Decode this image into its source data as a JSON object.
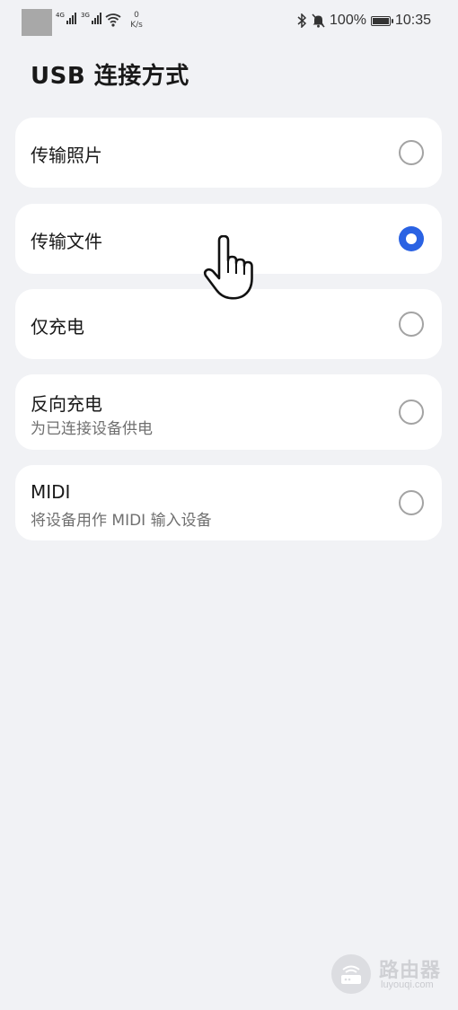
{
  "status_bar": {
    "net1": "4G",
    "net2": "3G",
    "speed_value": "0",
    "speed_unit": "K/s",
    "battery": "100%",
    "time": "10:35",
    "battery_level": 1.0,
    "icons": [
      "bluetooth-icon",
      "mute-icon",
      "wifi-icon",
      "signal-icon",
      "battery-icon"
    ]
  },
  "page": {
    "title": "USB 连接方式"
  },
  "options": [
    {
      "label": "传输照片",
      "selected": false
    },
    {
      "label": "传输文件",
      "selected": true
    },
    {
      "label": "仅充电",
      "selected": false
    },
    {
      "label": "反向充电",
      "subtitle": "为已连接设备供电",
      "selected": false
    },
    {
      "label": "MIDI",
      "subtitle": "将设备用作 MIDI 输入设备",
      "selected": false
    }
  ],
  "watermark": {
    "text": "路由器",
    "subtext": "luyouqi.com"
  },
  "colors": {
    "accent": "#2a62e3",
    "background": "#f1f2f5",
    "card": "#ffffff"
  }
}
